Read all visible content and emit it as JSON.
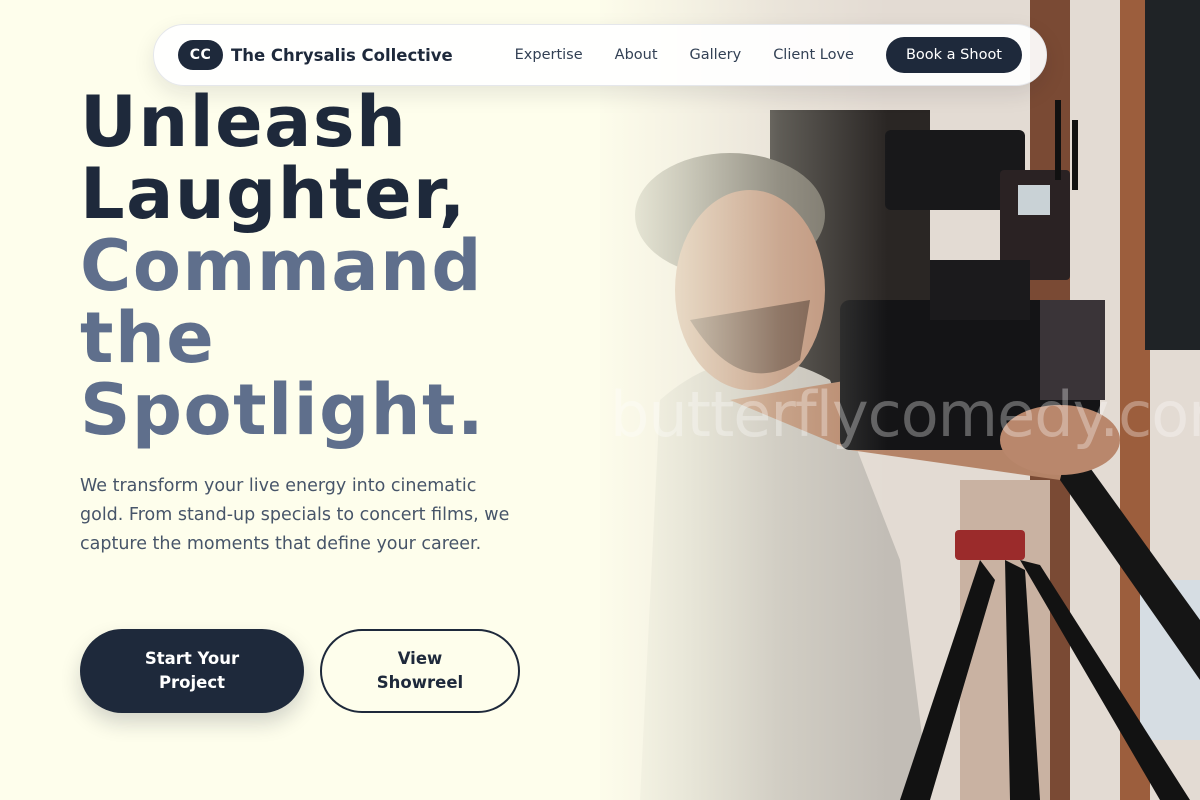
{
  "brand": {
    "mark": "CC",
    "name": "The Chrysalis Collective"
  },
  "nav": {
    "links": [
      "Expertise",
      "About",
      "Gallery",
      "Client Love"
    ],
    "cta": "Book a Shoot"
  },
  "hero": {
    "headline_dark": [
      "Unleash",
      "Laughter,"
    ],
    "headline_muted": [
      "Command",
      "the",
      "Spotlight."
    ],
    "lede": "We transform your live energy into cinematic gold. From stand-up specials to concert films, we capture the moments that define your career.",
    "primary_button": "Start Your Project",
    "secondary_button": "View Showreel"
  },
  "photo": {
    "watermark": "butterflycomedy.com"
  },
  "colors": {
    "background": "#fefeec",
    "navy": "#1e293b",
    "muted_slate": "#5f6f8c",
    "body_text": "#475569"
  }
}
